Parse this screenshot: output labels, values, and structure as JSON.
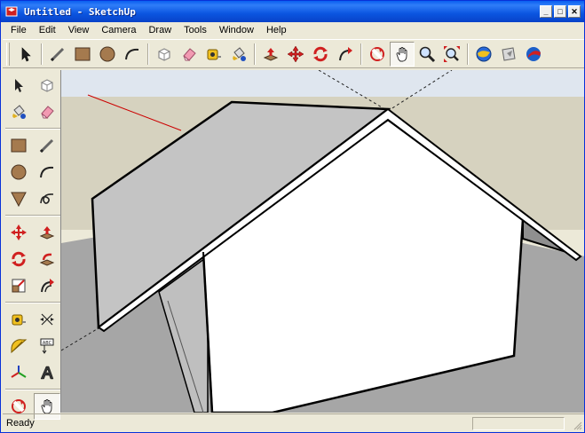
{
  "window": {
    "title": "Untitled - SketchUp",
    "controls": {
      "minimize": "_",
      "maximize": "□",
      "close": "✕"
    }
  },
  "menu": [
    "File",
    "Edit",
    "View",
    "Camera",
    "Draw",
    "Tools",
    "Window",
    "Help"
  ],
  "toolbar_top": [
    "select-icon",
    "line-icon",
    "rectangle-icon",
    "circle-icon",
    "arc-icon",
    "make-component-icon",
    "eraser-icon",
    "tape-measure-icon",
    "paint-bucket-icon",
    "push-pull-icon",
    "move-icon",
    "rotate-icon",
    "follow-me-icon",
    "orbit-icon",
    "pan-icon",
    "zoom-icon",
    "zoom-extents-icon",
    "get-models-icon",
    "share-model-icon",
    "google-earth-icon"
  ],
  "toolbar_left": [
    "select-icon",
    "make-component-icon",
    "paint-bucket-icon",
    "eraser-icon",
    "rectangle-icon",
    "line-icon",
    "circle-icon",
    "arc-icon",
    "polygon-icon",
    "freehand-icon",
    "move-icon",
    "push-pull-icon",
    "rotate-icon",
    "follow-me-icon",
    "scale-icon",
    "offset-icon",
    "tape-measure-icon",
    "dimension-icon",
    "protractor-icon",
    "text-icon",
    "axes-icon",
    "3d-text-icon",
    "orbit-icon",
    "pan-icon"
  ],
  "status": {
    "text": "Ready"
  },
  "colors": {
    "sky": "#dfe6ef",
    "ground": "#a6a6a6",
    "horizon": "#d6d2bf",
    "roof": "#c4c4c4",
    "wall": "#ffffff",
    "shadow_wall": "#bfbfbf",
    "red_axis": "#cc0000"
  }
}
